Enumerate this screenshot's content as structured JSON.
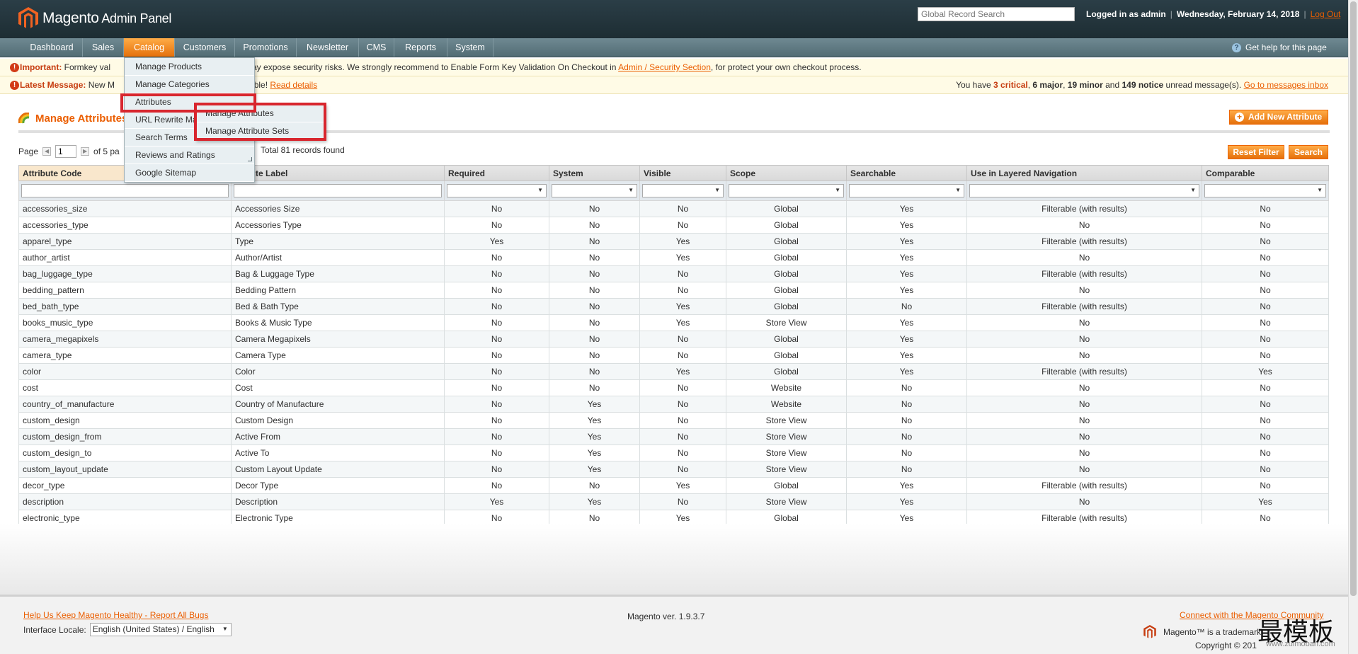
{
  "header": {
    "brand": "Magento",
    "brand_suffix": " Admin Panel",
    "search_placeholder": "Global Record Search",
    "logged_in": "Logged in as admin",
    "date": "Wednesday, February 14, 2018",
    "logout": "Log Out"
  },
  "nav": {
    "items": [
      "Dashboard",
      "Sales",
      "Catalog",
      "Customers",
      "Promotions",
      "Newsletter",
      "CMS",
      "Reports",
      "System"
    ],
    "active": "Catalog",
    "help": "Get help for this page"
  },
  "notices": {
    "important_label": "Important:",
    "important_text_a": " Formkey val",
    "important_text_b": "may expose security risks. We strongly recommend to Enable Form Key Validation On Checkout in ",
    "important_link": "Admin / Security Section",
    "important_text_c": ", for protect your own checkout process.",
    "latest_label": "Latest Message:",
    "latest_text_a": " New M",
    "latest_text_b": "able! ",
    "latest_link": "Read details",
    "summary_a": "You have ",
    "critical": "3 critical",
    "major": "6 major",
    "minor": "19 minor",
    "notice": "149 notice",
    "summary_b": " unread message(s). ",
    "inbox_link": "Go to messages inbox"
  },
  "page": {
    "title": "Manage Attributes",
    "add_button": "Add New Attribute",
    "pager_page": "Page",
    "pager_value": "1",
    "pager_of": "of 5 pa",
    "total": "Total 81 records found",
    "reset_filter": "Reset Filter",
    "search": "Search"
  },
  "menu": {
    "items": [
      "Manage Products",
      "Manage Categories",
      "Attributes",
      "URL Rewrite Ma",
      "Search Terms",
      "Reviews and Ratings",
      "Google Sitemap"
    ],
    "submenu": [
      "Manage Attributes",
      "Manage Attribute Sets"
    ]
  },
  "grid": {
    "headers": [
      "Attribute Code",
      "ibute Label",
      "Required",
      "System",
      "Visible",
      "Scope",
      "Searchable",
      "Use in Layered Navigation",
      "Comparable"
    ],
    "rows": [
      [
        "accessories_size",
        "Accessories Size",
        "No",
        "No",
        "No",
        "Global",
        "Yes",
        "Filterable (with results)",
        "No"
      ],
      [
        "accessories_type",
        "Accessories Type",
        "No",
        "No",
        "No",
        "Global",
        "Yes",
        "No",
        "No"
      ],
      [
        "apparel_type",
        "Type",
        "Yes",
        "No",
        "Yes",
        "Global",
        "Yes",
        "Filterable (with results)",
        "No"
      ],
      [
        "author_artist",
        "Author/Artist",
        "No",
        "No",
        "Yes",
        "Global",
        "Yes",
        "No",
        "No"
      ],
      [
        "bag_luggage_type",
        "Bag & Luggage Type",
        "No",
        "No",
        "No",
        "Global",
        "Yes",
        "Filterable (with results)",
        "No"
      ],
      [
        "bedding_pattern",
        "Bedding Pattern",
        "No",
        "No",
        "No",
        "Global",
        "Yes",
        "No",
        "No"
      ],
      [
        "bed_bath_type",
        "Bed & Bath Type",
        "No",
        "No",
        "Yes",
        "Global",
        "No",
        "Filterable (with results)",
        "No"
      ],
      [
        "books_music_type",
        "Books & Music Type",
        "No",
        "No",
        "Yes",
        "Store View",
        "Yes",
        "No",
        "No"
      ],
      [
        "camera_megapixels",
        "Camera Megapixels",
        "No",
        "No",
        "No",
        "Global",
        "Yes",
        "No",
        "No"
      ],
      [
        "camera_type",
        "Camera Type",
        "No",
        "No",
        "No",
        "Global",
        "Yes",
        "No",
        "No"
      ],
      [
        "color",
        "Color",
        "No",
        "No",
        "Yes",
        "Global",
        "Yes",
        "Filterable (with results)",
        "Yes"
      ],
      [
        "cost",
        "Cost",
        "No",
        "No",
        "No",
        "Website",
        "No",
        "No",
        "No"
      ],
      [
        "country_of_manufacture",
        "Country of Manufacture",
        "No",
        "Yes",
        "No",
        "Website",
        "No",
        "No",
        "No"
      ],
      [
        "custom_design",
        "Custom Design",
        "No",
        "Yes",
        "No",
        "Store View",
        "No",
        "No",
        "No"
      ],
      [
        "custom_design_from",
        "Active From",
        "No",
        "Yes",
        "No",
        "Store View",
        "No",
        "No",
        "No"
      ],
      [
        "custom_design_to",
        "Active To",
        "No",
        "Yes",
        "No",
        "Store View",
        "No",
        "No",
        "No"
      ],
      [
        "custom_layout_update",
        "Custom Layout Update",
        "No",
        "Yes",
        "No",
        "Store View",
        "No",
        "No",
        "No"
      ],
      [
        "decor_type",
        "Decor Type",
        "No",
        "No",
        "Yes",
        "Global",
        "Yes",
        "Filterable (with results)",
        "No"
      ],
      [
        "description",
        "Description",
        "Yes",
        "Yes",
        "No",
        "Store View",
        "Yes",
        "No",
        "Yes"
      ],
      [
        "electronic_type",
        "Electronic Type",
        "No",
        "No",
        "Yes",
        "Global",
        "Yes",
        "Filterable (with results)",
        "No"
      ]
    ]
  },
  "footer": {
    "bugs_link": "Help Us Keep Magento Healthy - Report All Bugs",
    "locale_label": "Interface Locale:",
    "locale_value": "English (United States) / English",
    "version": "Magento ver. 1.9.3.7",
    "connect_link": "Connect with the Magento Community",
    "trademark": "Magento™ is a trademark",
    "copyright": "Copyright © 201",
    "watermark": "最模板",
    "watermark_url": "www.zuimoban.com"
  },
  "colors": {
    "accent": "#eb5e00",
    "header_bg": "#2b3e47",
    "nav_bg": "#6f8992",
    "highlight": "#d8262e"
  }
}
